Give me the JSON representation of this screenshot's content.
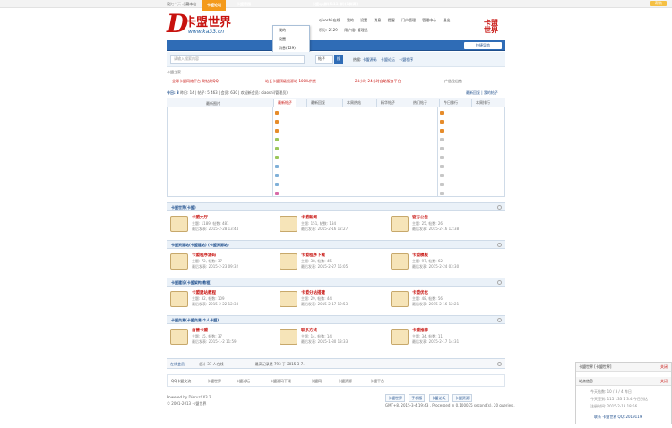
{
  "topbar": {
    "left": "设为首页  收藏本站",
    "right": "帮助"
  },
  "logo": {
    "mark": "D",
    "name": "卡盟世界",
    "url": "www.ka33.cn"
  },
  "user": {
    "line1": [
      "qiaoshi 在线",
      "我的",
      "设置",
      "消息",
      "提醒",
      "门户管理",
      "管理中心",
      "退出"
    ],
    "line2": [
      "积分: 2129",
      "用户组: 管理员"
    ],
    "brand": "卡盟\n世界"
  },
  "nav": {
    "items": [
      "卡盟世界",
      "卡盟论坛",
      "卡盟家园",
      "卡盟群组",
      "卡盟博客",
      "卡盟相册",
      "卡盟qq群(5:11 群)(1群满)"
    ],
    "active_index": 1,
    "quick": "快捷导航"
  },
  "dropdown": [
    "我的",
    "设置",
    "消息(129)",
    "提醒(5)"
  ],
  "search": {
    "placeholder": "请输入搜索内容",
    "select": "帖子",
    "btn": "搜",
    "hot_label": "热搜:",
    "hot": [
      "卡盟源码",
      "卡盟论坛",
      "卡盟程序"
    ]
  },
  "crumb": "卡盟之家",
  "links_row": [
    {
      "text": "全球卡盟网络平台-刷钻刷QQ",
      "color": "#c7120e"
    },
    {
      "text": "站长卡盟顶级货源站-100%供货",
      "color": "#c7120e"
    },
    {
      "text": "24小时-24小时自助服务平台",
      "color": "#c7120e"
    },
    {
      "text": "广告位出售",
      "color": "#555"
    }
  ],
  "announce": {
    "label": "今日: 3",
    "text": "昨日: 14  |  帖子: 5 463  |  会员: 630  |  欢迎新会员: qiaoshi(管理员)",
    "right": "最新回复 | 我的帖子"
  },
  "table": {
    "left_header": "最新图片",
    "tabs": [
      "最新帖子",
      "最新回复",
      "本周热帖",
      "精华帖子",
      "热门帖子"
    ],
    "right_tabs": [
      "今日排行",
      "本周排行"
    ]
  },
  "sections": [
    {
      "title": "卡盟世界(卡盟)",
      "forums": [
        {
          "name": "卡盟大厅",
          "meta1": "主题: 1189, 帖数: 481",
          "meta2": "最后发表: 2015-2-28 13:44"
        },
        {
          "name": "卡盟新闻",
          "meta1": "主题: 151, 帖数: 134",
          "meta2": "最后发表: 2015-2-16 12:27"
        },
        {
          "name": "官方公告",
          "meta1": "主题: 25, 帖数: 26",
          "meta2": "最后发表: 2015-2-16 12:38"
        }
      ]
    },
    {
      "title": "卡盟资源站(卡盟建站) (卡盟资源站)",
      "forums": [
        {
          "name": "卡盟程序源码",
          "meta1": "主题: 72, 帖数: 37",
          "meta2": "最后发表: 2015-2-23 09:32"
        },
        {
          "name": "卡盟程序下载",
          "meta1": "主题: 38, 帖数: 45",
          "meta2": "最后发表: 2015-2-27 15:05"
        },
        {
          "name": "卡盟模板",
          "meta1": "主题: 97, 帖数: 62",
          "meta2": "最后发表: 2015-2-24 03:30"
        }
      ]
    },
    {
      "title": "卡盟建设(卡盟架构 教程)",
      "forums": [
        {
          "name": "卡盟建站教程",
          "meta1": "主题: 32, 帖数: 109",
          "meta2": "最后发表: 2015-2-22 12:38"
        },
        {
          "name": "卡盟分站搭建",
          "meta1": "主题: 29, 帖数: 44",
          "meta2": "最后发表: 2015-2-17 19:53"
        },
        {
          "name": "卡盟优化",
          "meta1": "主题: 48, 帖数: 56",
          "meta2": "最后发表: 2015-2-16 12:21"
        }
      ]
    },
    {
      "title": "卡盟交易(卡盟交易 个人卡盟)",
      "forums": [
        {
          "name": "自营卡盟",
          "meta1": "主题: 15, 帖数: 37",
          "meta2": "最后发表: 2015-1-2 11:59"
        },
        {
          "name": "联系方式",
          "meta1": "主题: 14, 帖数: 14",
          "meta2": "最后发表: 2015-1-30 13:33"
        },
        {
          "name": "卡盟推荐",
          "meta1": "主题: 34, 帖数: 11",
          "meta2": "最后发表: 2015-2-17 14:31"
        }
      ]
    }
  ],
  "stats": [
    "在线会员",
    "总计 37 人在线",
    "- 最高记录是 793 于 2015-3-7."
  ],
  "flinks": [
    "QQ卡盟交流",
    "卡盟世界",
    "卡盟论坛",
    "卡盟源码下载",
    "卡盟网",
    "卡盟资源",
    "卡盟平台"
  ],
  "footer": {
    "left1": "Powered by Discuz! X3.2",
    "left2": "© 2001-2013 卡盟世界",
    "btns": [
      "卡盟世界",
      "手机版",
      "卡盟论坛",
      "卡盟资源"
    ],
    "right2": "GMT+8, 2015-3-4 19:43 , Processed in 0.100035 second(s), 20 queries ."
  },
  "rpanel": {
    "r1": "卡盟世界 [卡盟世界]",
    "r1s": "关闭",
    "r2": "站点信息",
    "r2s": "关闭",
    "lines": [
      "今天帖数: 10 / 3 / 4 昨日",
      "今天签到: 115 133 1 3.4 今日到达",
      "注册时间: 2015-2-18 18:56"
    ],
    "foot": "联系 卡盟世界 QQ: 2019119"
  }
}
